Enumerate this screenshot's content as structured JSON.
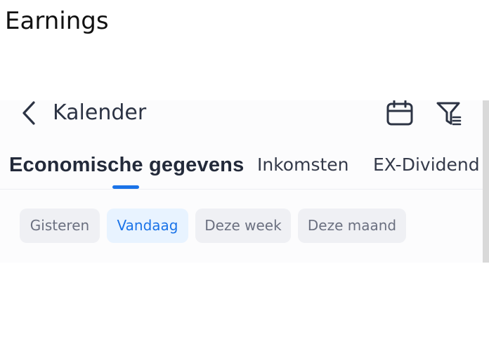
{
  "caption": "Earnings",
  "topbar": {
    "title": "Kalender",
    "icons": [
      "chevron-left-icon",
      "calendar-icon",
      "filter-icon"
    ]
  },
  "tabs": [
    {
      "label": "Economische gegevens",
      "active": true
    },
    {
      "label": "Inkomsten",
      "active": false
    },
    {
      "label": "EX-Dividend",
      "active": false
    }
  ],
  "date_filters": [
    {
      "label": "Gisteren",
      "active": false
    },
    {
      "label": "Vandaag",
      "active": true
    },
    {
      "label": "Deze week",
      "active": false
    },
    {
      "label": "Deze maand",
      "active": false
    }
  ],
  "colors": {
    "accent": "#1a73e8",
    "text_primary": "#2c3344",
    "chip_bg": "#eff0f4",
    "chip_active_bg": "#e8f3ff"
  }
}
